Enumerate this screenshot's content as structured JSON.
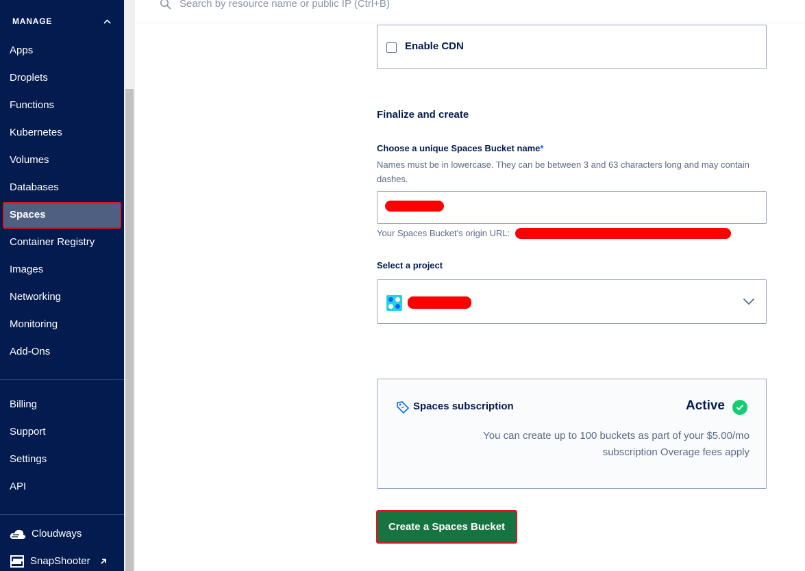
{
  "sidebar": {
    "section_label": "MANAGE",
    "items": [
      {
        "label": "Apps"
      },
      {
        "label": "Droplets"
      },
      {
        "label": "Functions"
      },
      {
        "label": "Kubernetes"
      },
      {
        "label": "Volumes"
      },
      {
        "label": "Databases"
      },
      {
        "label": "Spaces",
        "active": true
      },
      {
        "label": "Container Registry"
      },
      {
        "label": "Images"
      },
      {
        "label": "Networking"
      },
      {
        "label": "Monitoring"
      },
      {
        "label": "Add-Ons"
      }
    ],
    "account_items": [
      {
        "label": "Billing"
      },
      {
        "label": "Support"
      },
      {
        "label": "Settings"
      },
      {
        "label": "API"
      }
    ],
    "external_items": [
      {
        "label": "Cloudways",
        "icon": "cloudways-icon"
      },
      {
        "label": "SnapShooter",
        "icon": "snapshooter-icon",
        "external": true
      }
    ]
  },
  "search": {
    "placeholder": "Search by resource name or public IP (Ctrl+B)"
  },
  "cdn": {
    "label": "Enable CDN",
    "checked": false
  },
  "finalize": {
    "title": "Finalize and create",
    "name_label": "Choose a unique Spaces Bucket name",
    "required_mark": "*",
    "help_text": "Names must be in lowercase. They can be between 3 and 63 characters long and may contain dashes.",
    "name_value": "",
    "origin_label": "Your Spaces Bucket's origin URL:",
    "project_label": "Select a project",
    "project_value": ""
  },
  "subscription": {
    "title": "Spaces subscription",
    "status": "Active",
    "note": "You can create up to 100 buckets as part of your $5.00/mo subscription Overage fees apply"
  },
  "create_button": {
    "label": "Create a Spaces Bucket"
  },
  "colors": {
    "sidebar_bg": "#031b4e",
    "primary_text": "#031b4e",
    "accent_blue": "#0069ff",
    "create_green": "#15743f",
    "status_green": "#15cd72",
    "highlight_red": "#e0141e",
    "redaction_red": "#ff0000"
  }
}
